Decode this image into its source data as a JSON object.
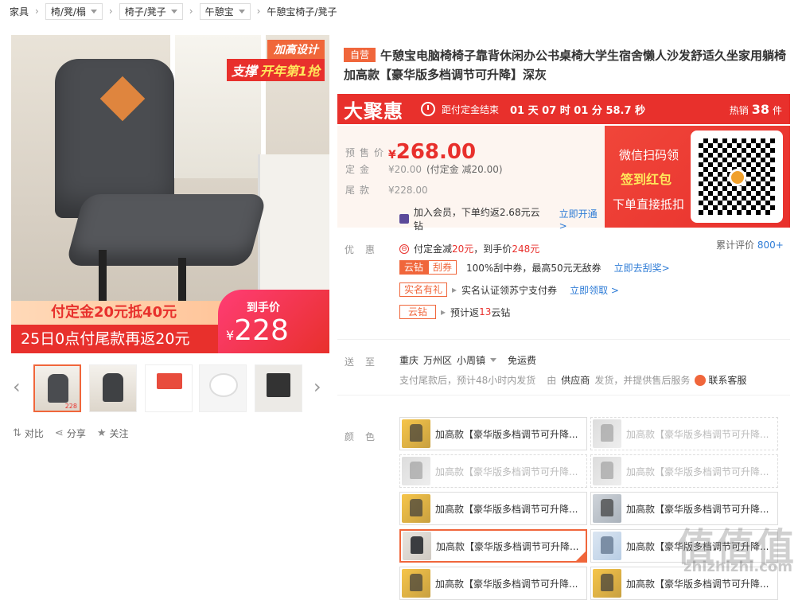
{
  "breadcrumb": {
    "home": "家具",
    "cat1": "椅/凳/榻",
    "cat2": "椅子/凳子",
    "brand": "午憩宝",
    "current": "午憩宝椅子/凳子"
  },
  "main_image": {
    "tag_top": "加高设计",
    "tag_support": "支撑",
    "tag_festival": "开年第1抢",
    "banner1": "付定金20元抵40元",
    "banner2": "25日0点付尾款再返20元",
    "badge_label": "到手价",
    "badge_currency": "¥",
    "badge_price": "228"
  },
  "thumbnails": {
    "prev_icon": "‹",
    "next_icon": "›",
    "active_price": "228"
  },
  "actions": {
    "compare": "对比",
    "share": "分享",
    "follow": "关注"
  },
  "product": {
    "self_tag": "自营",
    "title": "午憩宝电脑椅椅子靠背休闲办公书桌椅大学生宿舍懒人沙发舒适久坐家用躺椅 加高款【豪华版多档调节可升降】深灰"
  },
  "flash": {
    "logo": "大聚惠",
    "countdown_label": "距付定金结束",
    "countdown": "01 天 07 时 01 分 58.7 秒",
    "hot_label": "热销",
    "hot_count": "38",
    "hot_unit": "件"
  },
  "price": {
    "presale_label": "预售价",
    "presale_currency": "¥",
    "presale_value": "268.00",
    "deposit_label": "定金",
    "deposit_value": "¥20.00",
    "deposit_note": "(付定金 减20.00)",
    "balance_label": "尾款",
    "balance_value": "¥228.00",
    "vip_text": "加入会员，下单约返2.68元云钻",
    "vip_link": "立即开通>"
  },
  "qr_promo": {
    "line1": "微信扫码领",
    "line2": "签到红包",
    "line3": "下单直接抵扣"
  },
  "promotions": {
    "label": "优惠",
    "row1_prefix": "付定金减",
    "row1_amount": "20元",
    "row1_mid": "，到手价",
    "row1_price": "248元",
    "row2_tag1": "云钻",
    "row2_tag2": "刮券",
    "row2_text": "100%刮中券，最高50元无敌券",
    "row2_link": "立即去刮奖>",
    "row3_tag": "实名有礼",
    "row3_text": "实名认证领苏宁支付券",
    "row3_link": "立即领取 >",
    "row4_tag": "云钻",
    "row4_text_a": "预计返",
    "row4_num": "13",
    "row4_text_b": "云钻",
    "review_label": "累计评价",
    "review_count": "800+"
  },
  "shipping": {
    "label": "送至",
    "city": "重庆",
    "district": "万州区",
    "town": "小周镇",
    "free": "免运费",
    "note_a": "支付尾款后，预计48小时内发货",
    "note_b": "由",
    "seller": "供应商",
    "note_c": "发货，并提供售后服务",
    "service": "联系客服"
  },
  "colors": {
    "label": "颜色",
    "option_text": "加高款【豪华版多档调节可升降..."
  },
  "watermark": {
    "big": "值值值",
    "small": "zhizhizhi.com"
  }
}
